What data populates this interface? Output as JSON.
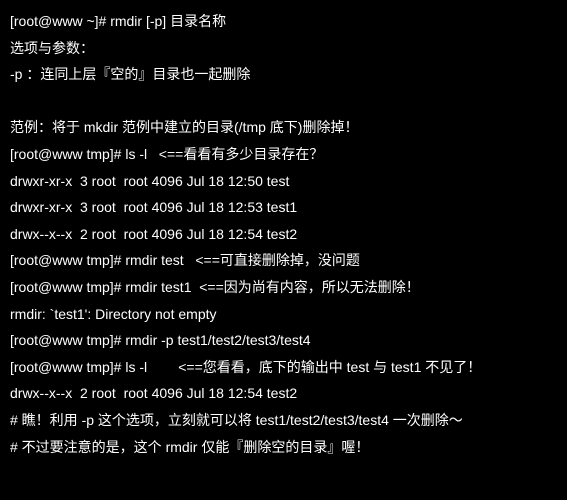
{
  "terminal": {
    "lines": [
      "[root@www ~]# rmdir [-p] 目录名称",
      "选项与参数：",
      "-p ：连同上层『空的』目录也一起删除",
      "",
      "范例：将于 mkdir 范例中建立的目录(/tmp 底下)删除掉！",
      "[root@www tmp]# ls -l   <==看看有多少目录存在？",
      "drwxr-xr-x  3 root  root 4096 Jul 18 12:50 test",
      "drwxr-xr-x  3 root  root 4096 Jul 18 12:53 test1",
      "drwx--x--x  2 root  root 4096 Jul 18 12:54 test2",
      "[root@www tmp]# rmdir test   <==可直接删除掉，没问题",
      "[root@www tmp]# rmdir test1  <==因为尚有内容，所以无法删除！",
      "rmdir: `test1': Directory not empty",
      "[root@www tmp]# rmdir -p test1/test2/test3/test4",
      "[root@www tmp]# ls -l        <==您看看，底下的输出中 test 与 test1 不见了！",
      "drwx--x--x  2 root  root 4096 Jul 18 12:54 test2",
      "# 瞧！利用 -p 这个选项，立刻就可以将 test1/test2/test3/test4 一次删除～",
      "# 不过要注意的是，这个 rmdir 仅能『删除空的目录』喔！"
    ]
  }
}
